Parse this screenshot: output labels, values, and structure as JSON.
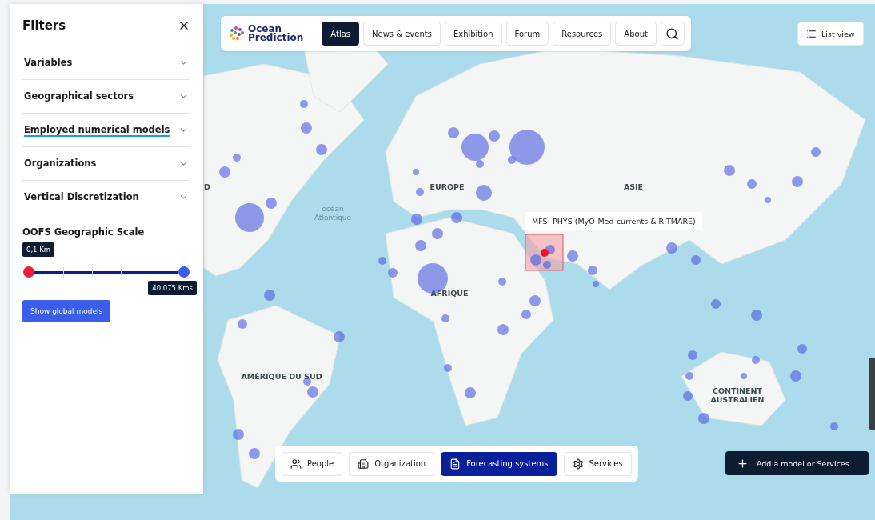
{
  "filters_panel": {
    "title": "Filters",
    "sections": [
      {
        "label": "Variables",
        "expanded": false,
        "hovered": false
      },
      {
        "label": "Geographical sectors",
        "expanded": false,
        "hovered": false
      },
      {
        "label": "Employed numerical models",
        "expanded": false,
        "hovered": true
      },
      {
        "label": "Organizations",
        "expanded": false,
        "hovered": false
      },
      {
        "label": "Vertical Discretization",
        "expanded": false,
        "hovered": false
      }
    ],
    "scale": {
      "title": "OOFS Geographic Scale",
      "thumbs": [
        {
          "level": 0,
          "reading": "0,1 Km"
        },
        {
          "level": 1,
          "reading": "40 075 Kms"
        }
      ]
    },
    "button": "Show global models"
  },
  "header": {
    "logo": {
      "line1": "Ocean",
      "line2": "Prediction"
    },
    "nav": [
      {
        "label": "Atlas",
        "selected": true
      },
      {
        "label": "News & events",
        "selected": false
      },
      {
        "label": "Exhibition",
        "selected": false
      },
      {
        "label": "Forum",
        "selected": false
      },
      {
        "label": "Resources",
        "selected": false
      },
      {
        "label": "About",
        "selected": false
      }
    ]
  },
  "list_view": "List view",
  "map": {
    "labels": [
      "D",
      "EUROPE",
      "ASIE",
      "océan Atlantique",
      "AFRIQUE",
      "AMÉRIQUE DU SUD",
      "CONTINENT AUSTRALIEN"
    ],
    "tooltip": "MFS- PHYS (MyO-Med-currents & RITMARE)"
  },
  "categories": [
    {
      "label": "People",
      "selected": false,
      "kind": "people"
    },
    {
      "label": "Organization",
      "selected": false,
      "kind": "organization"
    },
    {
      "label": "Forecasting systems",
      "selected": true,
      "kind": "document"
    },
    {
      "label": "Services",
      "selected": false,
      "kind": "settings"
    }
  ],
  "add_button": "Add a model or Services"
}
